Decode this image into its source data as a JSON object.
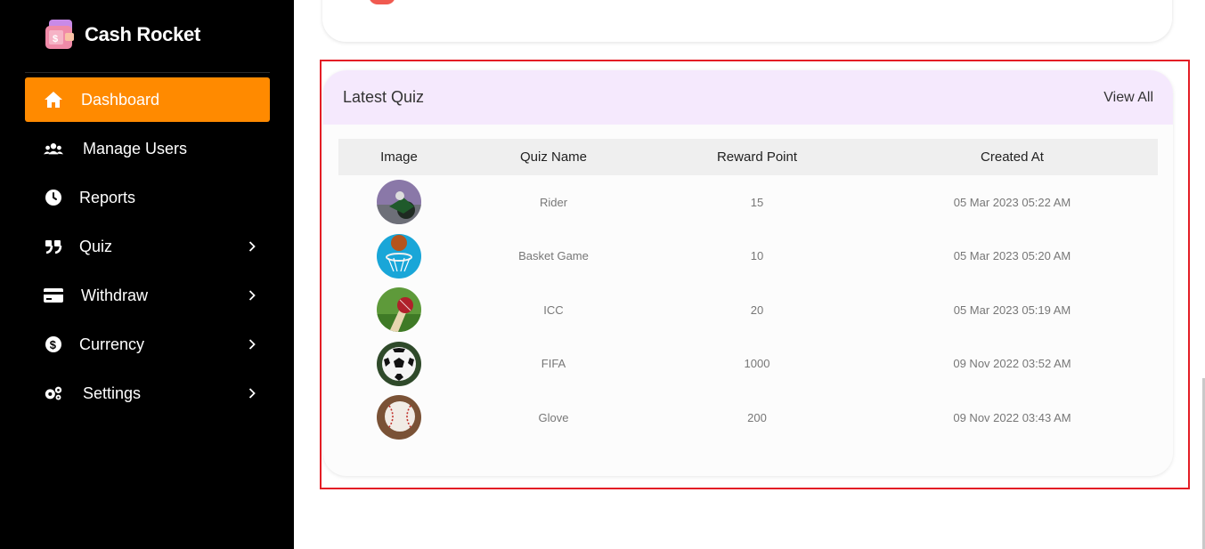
{
  "brand": {
    "name": "Cash Rocket"
  },
  "sidebar": {
    "items": [
      {
        "label": "Dashboard",
        "icon": "home-icon",
        "active": true,
        "has_submenu": false
      },
      {
        "label": "Manage Users",
        "icon": "users-icon",
        "active": false,
        "has_submenu": false
      },
      {
        "label": "Reports",
        "icon": "clock-icon",
        "active": false,
        "has_submenu": false
      },
      {
        "label": "Quiz",
        "icon": "quote-icon",
        "active": false,
        "has_submenu": true
      },
      {
        "label": "Withdraw",
        "icon": "credit-card-icon",
        "active": false,
        "has_submenu": true
      },
      {
        "label": "Currency",
        "icon": "dollar-circle-icon",
        "active": false,
        "has_submenu": true
      },
      {
        "label": "Settings",
        "icon": "gears-icon",
        "active": false,
        "has_submenu": true
      }
    ]
  },
  "latest_quiz": {
    "title": "Latest Quiz",
    "view_all": "View All",
    "columns": {
      "image": "Image",
      "name": "Quiz Name",
      "reward": "Reward Point",
      "created": "Created At"
    },
    "rows": [
      {
        "name": "Rider",
        "reward": "15",
        "created": "05 Mar 2023 05:22 AM",
        "image": "motorbike-rider-image"
      },
      {
        "name": "Basket Game",
        "reward": "10",
        "created": "05 Mar 2023 05:20 AM",
        "image": "basketball-hoop-image"
      },
      {
        "name": "ICC",
        "reward": "20",
        "created": "05 Mar 2023 05:19 AM",
        "image": "cricket-ball-image"
      },
      {
        "name": "FIFA",
        "reward": "1000",
        "created": "09 Nov 2022 03:52 AM",
        "image": "soccer-ball-image"
      },
      {
        "name": "Glove",
        "reward": "200",
        "created": "09 Nov 2022 03:43 AM",
        "image": "baseball-image"
      }
    ]
  },
  "colors": {
    "sidebar_bg": "#000000",
    "active_item": "#ff8a00",
    "card_header": "#f5e9fd",
    "highlight_border": "#e41e26"
  }
}
